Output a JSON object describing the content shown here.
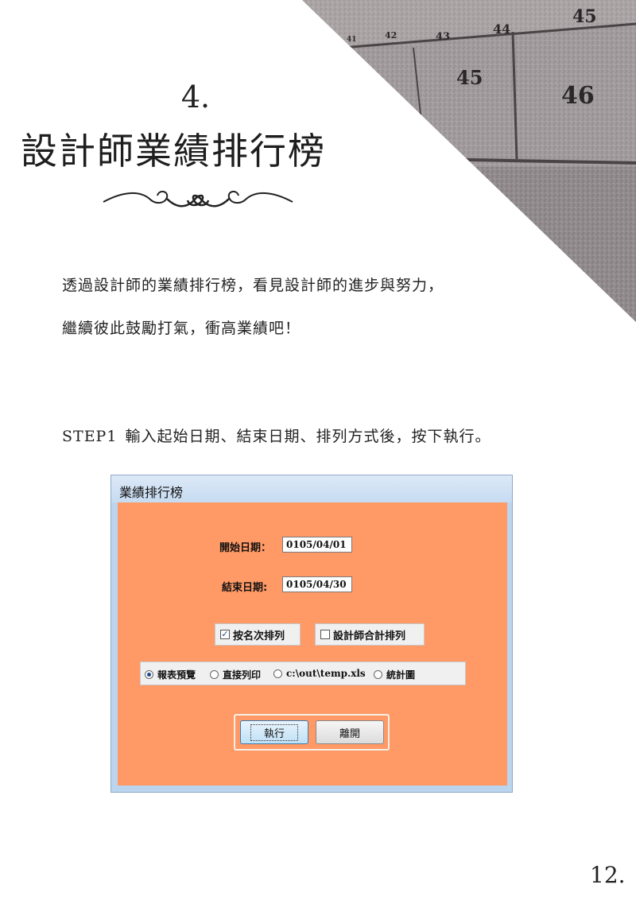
{
  "section": {
    "number": "4.",
    "title": "設計師業績排行榜"
  },
  "intro": {
    "line1": "透過設計師的業績排行榜，看見設計師的進步與努力，",
    "line2": "繼續彼此鼓勵打氣，衝高業績吧！"
  },
  "step": {
    "tag": "STEP1",
    "text": "輸入起始日期、結束日期、排列方式後，按下執行。"
  },
  "photo": {
    "seat_numbers": [
      "45",
      "44",
      "43",
      "42",
      "41",
      "45",
      "46"
    ]
  },
  "dialog": {
    "title": "業績排行榜",
    "start_date": {
      "label": "開始日期：",
      "value": "0105/04/01"
    },
    "end_date": {
      "label": "結束日期:",
      "value": "0105/04/30"
    },
    "checkboxes": [
      {
        "label": "按名次排列",
        "checked": true
      },
      {
        "label": "設計師合計排列",
        "checked": false
      }
    ],
    "radios": [
      {
        "label": "報表預覽",
        "selected": true
      },
      {
        "label": "直接列印",
        "selected": false
      },
      {
        "label": "c:\\out\\temp.xls",
        "selected": false
      },
      {
        "label": "統計圖",
        "selected": false
      }
    ],
    "buttons": {
      "run": "執行",
      "leave": "離開"
    },
    "colors": {
      "body": "#ff9966",
      "frame": "#bcd5ef"
    }
  },
  "page_number": "12."
}
